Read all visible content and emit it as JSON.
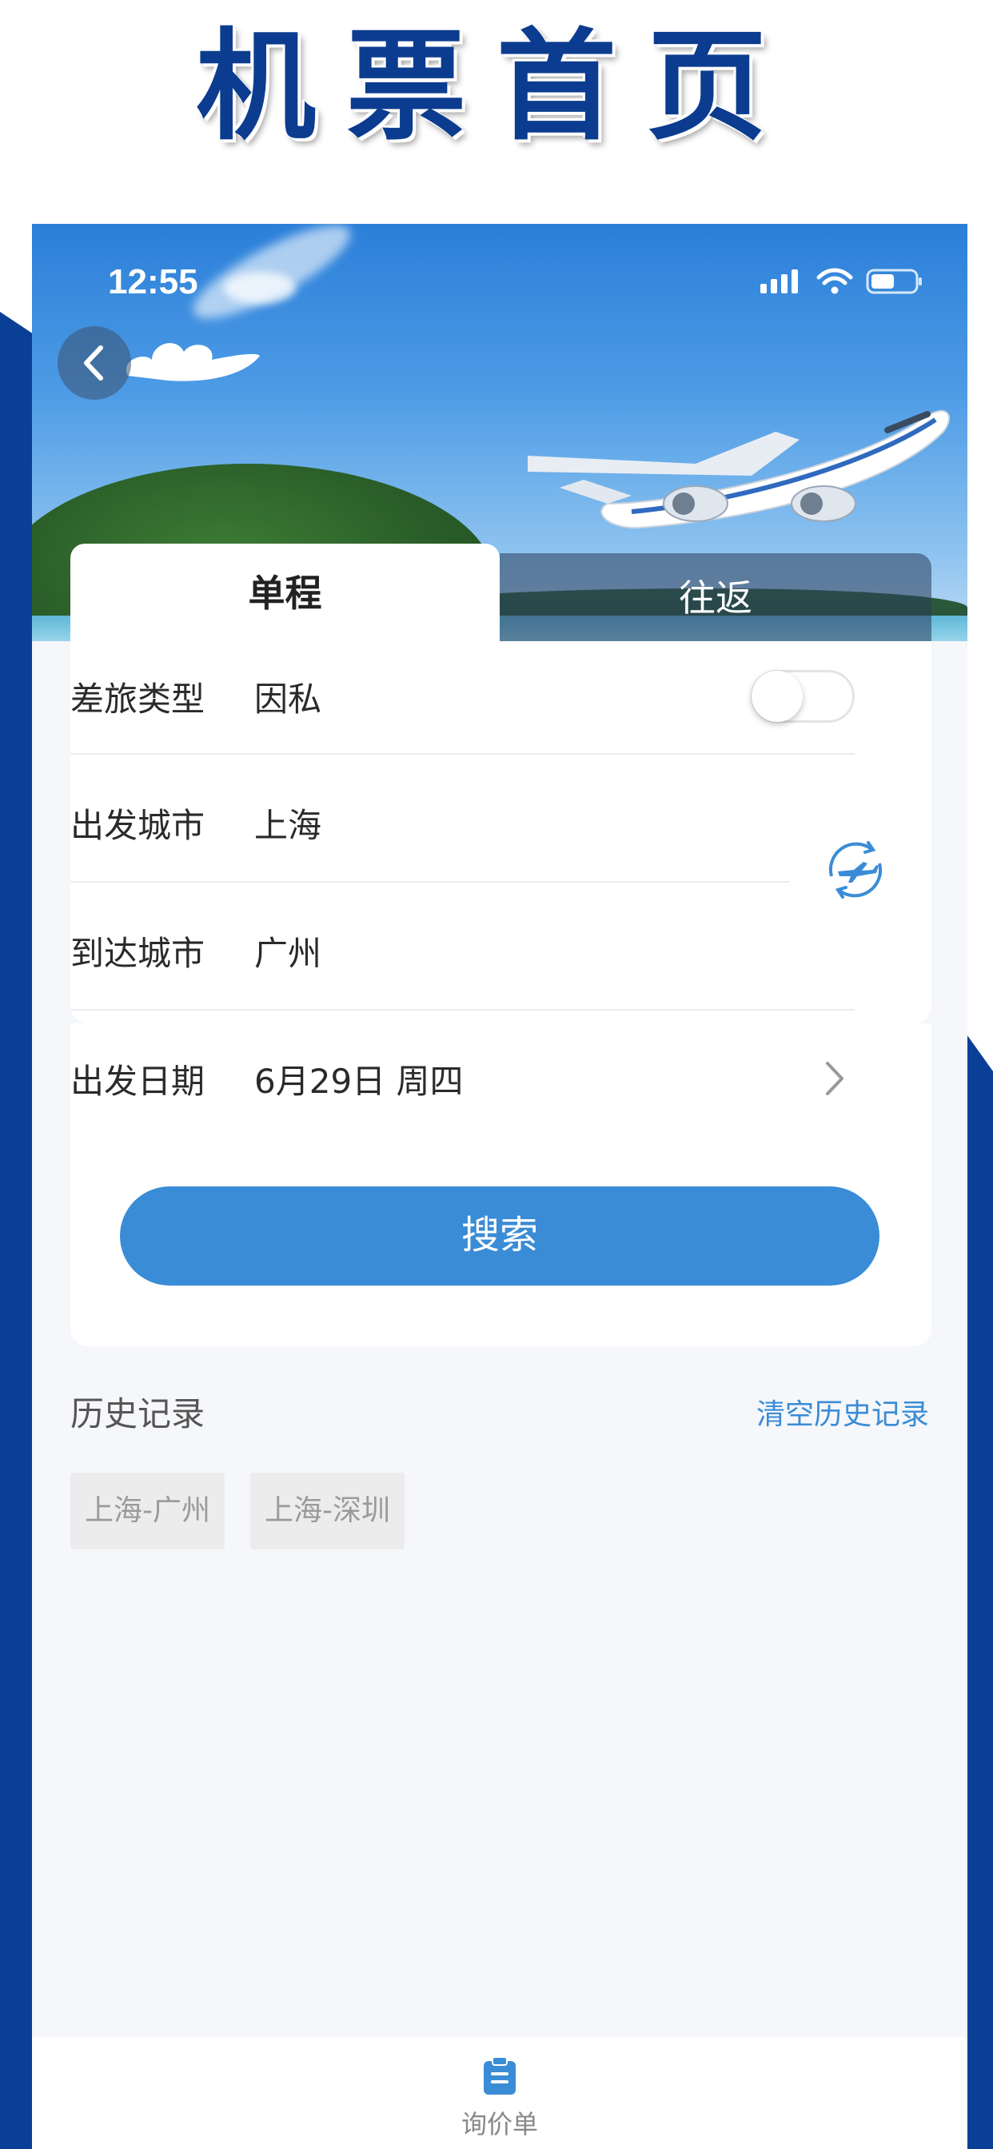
{
  "promo": {
    "title": "机票首页"
  },
  "status_bar": {
    "time": "12:55"
  },
  "tabs": [
    {
      "label": "单程",
      "active": true
    },
    {
      "label": "往返",
      "active": false
    }
  ],
  "form": {
    "travel_type": {
      "label": "差旅类型",
      "value": "因私",
      "toggle_on": false
    },
    "departure_city": {
      "label": "出发城市",
      "value": "上海"
    },
    "arrival_city": {
      "label": "到达城市",
      "value": "广州"
    },
    "departure_date": {
      "label": "出发日期",
      "value": "6月29日 周四"
    },
    "search_label": "搜索"
  },
  "history": {
    "title": "历史记录",
    "clear_label": "清空历史记录",
    "items": [
      "上海-广州",
      "上海-深圳"
    ]
  },
  "bottom_nav": {
    "label": "询价单"
  },
  "colors": {
    "brand_blue": "#0a3f96",
    "accent": "#3a8cd6"
  }
}
